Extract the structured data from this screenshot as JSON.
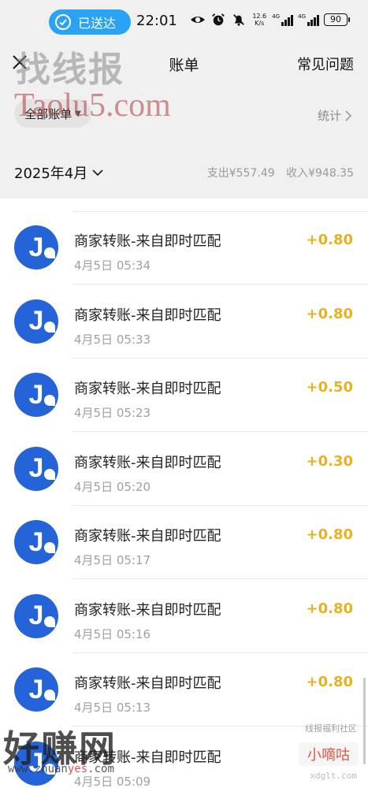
{
  "status_bar": {
    "sent_label": "已送达",
    "time": "22:01",
    "net_speed_value": "12.6",
    "net_speed_unit": "K/s",
    "battery": "90",
    "network_tag_1": "4G",
    "network_tag_2": "4G"
  },
  "header": {
    "title": "账单",
    "faq_label": "常见问题"
  },
  "filter": {
    "all_bills_label": "全部账单",
    "stats_label": "统计"
  },
  "month_summary": {
    "month_label": "2025年4月",
    "expense_label": "支出¥557.49",
    "income_label": "收入¥948.35"
  },
  "transactions": [
    {
      "title": "商家转账-来自即时匹配",
      "time": "4月5日 05:34",
      "amount": "+0.80"
    },
    {
      "title": "商家转账-来自即时匹配",
      "time": "4月5日 05:33",
      "amount": "+0.80"
    },
    {
      "title": "商家转账-来自即时匹配",
      "time": "4月5日 05:23",
      "amount": "+0.50"
    },
    {
      "title": "商家转账-来自即时匹配",
      "time": "4月5日 05:20",
      "amount": "+0.30"
    },
    {
      "title": "商家转账-来自即时匹配",
      "time": "4月5日 05:17",
      "amount": "+0.80"
    },
    {
      "title": "商家转账-来自即时匹配",
      "time": "4月5日 05:16",
      "amount": "+0.80"
    },
    {
      "title": "商家转账-来自即时匹配",
      "time": "4月5日 05:13",
      "amount": "+0.80"
    },
    {
      "title": "商家转账-来自即时匹配",
      "time": "4月5日 05:09",
      "amount": ""
    }
  ],
  "avatar_letter": "J",
  "watermarks": {
    "top_cn": "找线报",
    "top_en": "Taolu5.com",
    "bottom_cn": "好赚网",
    "bottom_url_prefix": "www.zhuan",
    "bottom_url_accent": "yes",
    "bottom_url_suffix": ".com",
    "right_caption": "线报福利社区",
    "right_logo": "小嘀咕",
    "right_url": "xdglt.com"
  },
  "colors": {
    "accent_amount": "#e5b320",
    "avatar_blue": "#2563d8",
    "pill_blue": "#2aa3f5"
  },
  "icons": [
    "check-icon",
    "eye-icon",
    "alarm-icon",
    "mute-bell-icon",
    "signal-icon",
    "close-icon",
    "caret-down-icon",
    "chevron-right-icon",
    "chevron-down-icon"
  ]
}
